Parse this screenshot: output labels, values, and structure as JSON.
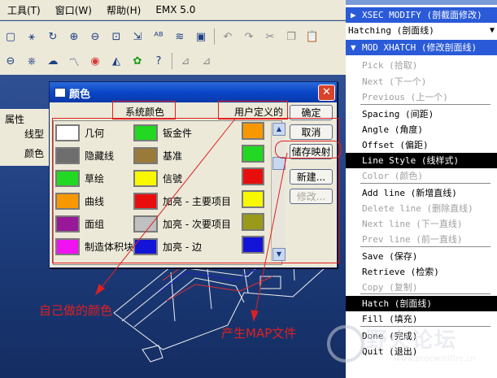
{
  "menubar": {
    "items": [
      "工具(T)",
      "窗口(W)",
      "帮助(H)",
      "EMX 5.0"
    ]
  },
  "toolbar": {
    "row1": [
      "view-icon",
      "nodes-icon",
      "refresh-icon",
      "zoom-in-icon",
      "zoom-out-icon",
      "zoom-fit-icon",
      "orient-icon",
      "text-icon",
      "layers-icon",
      "save-icon",
      "undo-icon",
      "redo-icon",
      "cut-icon",
      "copy-icon",
      "paste-icon"
    ],
    "row2": [
      "plane-icon",
      "kit-icon",
      "model-icon",
      "analysis-icon",
      "appearance-icon",
      "shade-icon",
      "color-wheel-icon",
      "help-icon",
      "datum-icon",
      "datum2-icon"
    ]
  },
  "prop_panel": {
    "label1": "属性",
    "label2": "线型",
    "label3": "颜色"
  },
  "color_dialog": {
    "title": "颜色",
    "tab_system": "系统颜色",
    "tab_user": "用户定义的",
    "swatches_left": [
      {
        "label": "几何",
        "color": "#ffffff"
      },
      {
        "label": "隐藏线",
        "color": "#6e6e6e"
      },
      {
        "label": "草绘",
        "color": "#22d822"
      },
      {
        "label": "曲线",
        "color": "#f89800"
      },
      {
        "label": "面组",
        "color": "#981898"
      },
      {
        "label": "制造体积块",
        "color": "#f012f0"
      }
    ],
    "swatches_right": [
      {
        "label": "钣金件",
        "color": "#22d822"
      },
      {
        "label": "基准",
        "color": "#9a7a3a"
      },
      {
        "label": "信號",
        "color": "#f8f800"
      },
      {
        "label": "加亮 - 主要项目",
        "color": "#e80e0e"
      },
      {
        "label": "加亮 - 次要项目",
        "color": "#c0c0c0"
      },
      {
        "label": "加亮 - 边",
        "color": "#1414d8"
      }
    ],
    "user_colors": [
      "#f89800",
      "#22d822",
      "#e80e0e",
      "#f8f800",
      "#9a9a1a",
      "#1414d8"
    ],
    "buttons": {
      "ok": "确定",
      "cancel": "取消",
      "save_map": "储存映射",
      "new": "新建...",
      "modify": "修改..."
    }
  },
  "menu_panel": {
    "header1": "XSEC MODIFY (剖截面修改)",
    "select_value": "Hatching (剖面线)",
    "header2": "MOD XHATCH (修改剖面线)",
    "items": [
      {
        "label": "Pick (拾取)",
        "state": "gray"
      },
      {
        "label": "Next (下一个)",
        "state": "gray"
      },
      {
        "label": "Previous (上一个)",
        "state": "gray"
      },
      {
        "label": "Spacing (间距)",
        "state": "normal"
      },
      {
        "label": "Angle (角度)",
        "state": "normal"
      },
      {
        "label": "Offset (偏距)",
        "state": "normal"
      },
      {
        "label": "Line Style (线样式)",
        "state": "selected"
      },
      {
        "label": "Color (颜色)",
        "state": "gray"
      },
      {
        "label": "Add line (新增直线)",
        "state": "normal"
      },
      {
        "label": "Delete line (删除直线)",
        "state": "gray"
      },
      {
        "label": "Next line (下一直线)",
        "state": "gray"
      },
      {
        "label": "Prev line (前一直线)",
        "state": "gray"
      },
      {
        "label": "Save (保存)",
        "state": "normal"
      },
      {
        "label": "Retrieve (检索)",
        "state": "normal"
      },
      {
        "label": "Copy (复制)",
        "state": "gray"
      },
      {
        "label": "Hatch (剖面线)",
        "state": "selected"
      },
      {
        "label": "Fill (填充)",
        "state": "normal"
      },
      {
        "label": "Done (完成)",
        "state": "normal"
      },
      {
        "label": "Quit (退出)",
        "state": "normal"
      }
    ]
  },
  "annotations": {
    "custom_color": "自己做的颜色",
    "map_file": "产生MAP文件"
  },
  "watermark": {
    "text": "野火论坛",
    "url": "www.proewildfire.cn"
  },
  "colors": {
    "annotation_red": "#e02020",
    "menu_blue": "#2a5ad8",
    "title_blue": "#0a46c8"
  }
}
